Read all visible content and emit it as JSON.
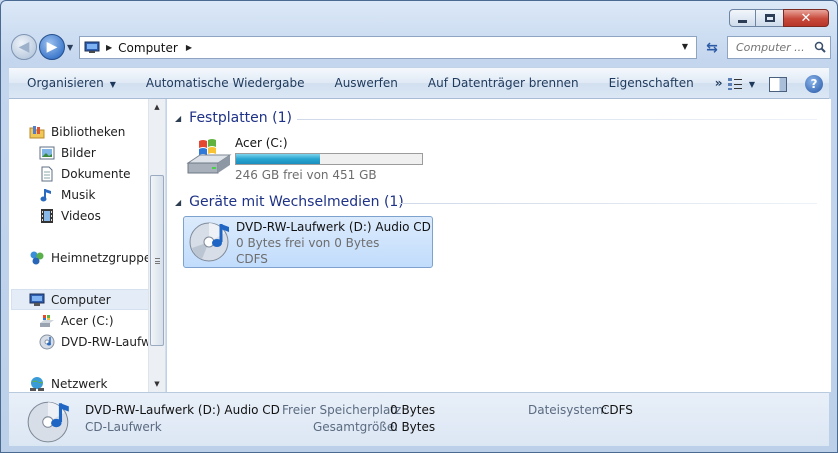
{
  "window": {
    "minimize_glyph": "minimize-icon",
    "maximize_glyph": "maximize-icon",
    "close_glyph": "✕"
  },
  "address_bar": {
    "segments": [
      "Computer"
    ],
    "search_placeholder": "Computer ..."
  },
  "commands": {
    "organize": "Organisieren",
    "autoplay": "Automatische Wiedergabe",
    "eject": "Auswerfen",
    "burn": "Auf Datenträger brennen",
    "properties": "Eigenschaften",
    "more": "»"
  },
  "nav": {
    "libraries": "Bibliotheken",
    "pictures": "Bilder",
    "documents": "Dokumente",
    "music": "Musik",
    "videos": "Videos",
    "homegroup": "Heimnetzgruppe",
    "computer": "Computer",
    "drive_c": "Acer (C:)",
    "drive_d": "DVD-RW-Laufwerk (D:) Audio CD",
    "network": "Netzwerk"
  },
  "groups": {
    "hard_disks": "Festplatten (1)",
    "removable": "Geräte mit Wechselmedien (1)"
  },
  "drives": {
    "c": {
      "name": "Acer (C:)",
      "free_text": "246 GB frei von 451 GB",
      "used_fraction": 0.45
    },
    "d": {
      "name": "DVD-RW-Laufwerk (D:) Audio CD",
      "free_text": "0 Bytes frei von 0 Bytes",
      "fs": "CDFS"
    }
  },
  "details": {
    "name": "DVD-RW-Laufwerk (D:) Audio CD",
    "type": "CD-Laufwerk",
    "free_label": "Freier Speicherplatz:",
    "free_value": "0 Bytes",
    "total_label": "Gesamtgröße:",
    "total_value": "0 Bytes",
    "fs_label": "Dateisystem:",
    "fs_value": "CDFS"
  },
  "colors": {
    "group_header": "#1e3287",
    "selection": "#c1dcfc",
    "usage_fill": "#27a4cf"
  }
}
